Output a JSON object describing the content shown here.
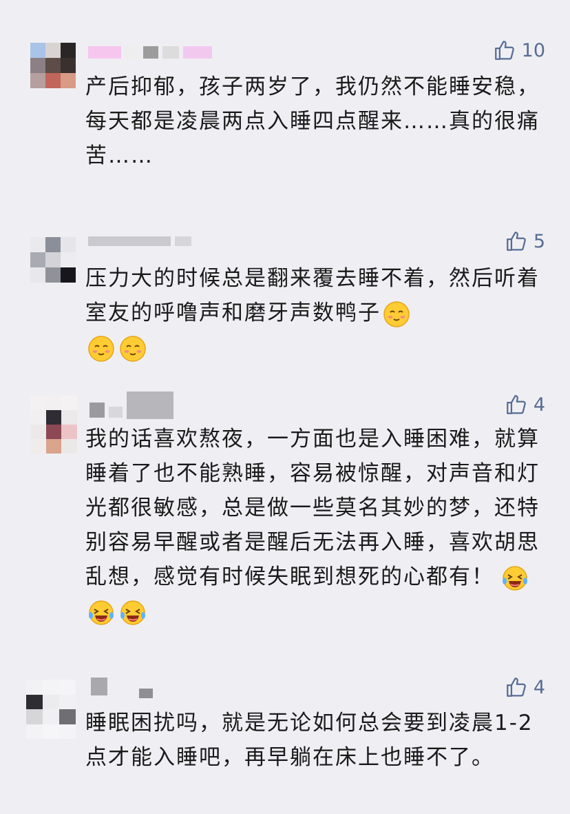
{
  "comments": [
    {
      "likes": "10",
      "text": "产后抑郁，孩子两岁了，我仍然不能睡安稳，每天都是凌晨两点入睡四点醒来……真的很痛苦……",
      "emojis": []
    },
    {
      "likes": "5",
      "text": "压力大的时候总是翻来覆去睡不着，然后听着室友的呼噜声和磨牙声数鸭子",
      "emojis": [
        "smile-blush-emoji",
        "smile-blush-emoji",
        "smile-blush-emoji"
      ]
    },
    {
      "likes": "4",
      "text": "我的话喜欢熬夜，一方面也是入睡困难，就算睡着了也不能熟睡，容易被惊醒，对声音和灯光都很敏感，总是做一些莫名其妙的梦，还特别容易早醒或者是醒后无法再入睡，喜欢胡思乱想，感觉有时候失眠到想死的心都有！",
      "emojis": [
        "laugh-tears-emoji",
        "laugh-tears-emoji",
        "laugh-tears-emoji"
      ]
    },
    {
      "likes": "4",
      "text": "睡眠困扰吗，就是无论如何总会要到凌晨1-2点才能入睡吧，再早躺在床上也睡不了。",
      "emojis": []
    }
  ],
  "colors": {
    "background": "#efeff3",
    "like": "#576b95",
    "text": "#1a1a1a"
  }
}
